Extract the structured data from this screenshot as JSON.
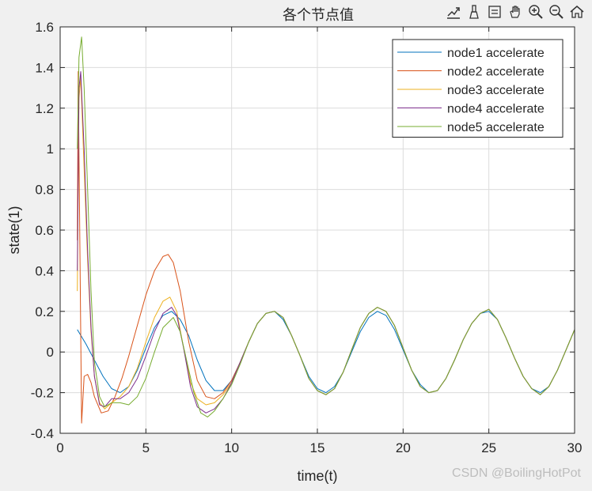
{
  "chart_data": {
    "type": "line",
    "title": "各个节点值",
    "xlabel": "time(t)",
    "ylabel": "state(1)",
    "xlim": [
      0,
      30
    ],
    "ylim": [
      -0.4,
      1.6
    ],
    "xticks": [
      "0",
      "5",
      "10",
      "15",
      "20",
      "25",
      "30"
    ],
    "yticks": [
      "-0.4",
      "-0.2",
      "0",
      "0.2",
      "0.4",
      "0.6",
      "0.8",
      "1",
      "1.2",
      "1.4",
      "1.6"
    ],
    "grid": true,
    "legend_position": "top-right",
    "series": [
      {
        "name": "node1 accelerate",
        "color": "#0072bd",
        "x": [
          1.0,
          1.5,
          2.0,
          2.5,
          3.0,
          3.5,
          4.0,
          4.5,
          5.0,
          5.5,
          6.0,
          6.5,
          7.0,
          7.5,
          8.0,
          8.5,
          9.0,
          9.5,
          10.0,
          10.5,
          11.0,
          11.5,
          12.0,
          12.5,
          13.0,
          13.5,
          14.0,
          14.5,
          15.0,
          15.5,
          16.0,
          16.5,
          17.0,
          17.5,
          18.0,
          18.5,
          19.0,
          19.5,
          20.0,
          20.5,
          21.0,
          21.5,
          22.0,
          22.5,
          23.0,
          23.5,
          24.0,
          24.5,
          25.0,
          25.5,
          26.0,
          26.5,
          27.0,
          27.5,
          28.0,
          28.5,
          29.0,
          29.5,
          30.0
        ],
        "y": [
          0.11,
          0.04,
          -0.04,
          -0.12,
          -0.18,
          -0.2,
          -0.17,
          -0.09,
          0.02,
          0.12,
          0.18,
          0.2,
          0.16,
          0.08,
          -0.04,
          -0.14,
          -0.19,
          -0.19,
          -0.14,
          -0.05,
          0.05,
          0.14,
          0.19,
          0.2,
          0.16,
          0.08,
          -0.02,
          -0.12,
          -0.18,
          -0.2,
          -0.17,
          -0.1,
          0.0,
          0.1,
          0.17,
          0.2,
          0.18,
          0.11,
          0.01,
          -0.09,
          -0.16,
          -0.2,
          -0.19,
          -0.13,
          -0.04,
          0.06,
          0.14,
          0.19,
          0.2,
          0.16,
          0.07,
          -0.03,
          -0.12,
          -0.18,
          -0.2,
          -0.17,
          -0.09,
          0.01,
          0.11
        ]
      },
      {
        "name": "node2 accelerate",
        "color": "#d95319",
        "x": [
          1.0,
          1.05,
          1.25,
          1.4,
          1.6,
          1.8,
          2.0,
          2.4,
          2.8,
          3.2,
          3.6,
          4.0,
          4.5,
          5.0,
          5.5,
          6.0,
          6.3,
          6.6,
          7.0,
          7.5,
          8.0,
          8.5,
          9.0,
          9.5,
          10.0,
          10.5,
          11.0,
          11.5,
          12.0,
          12.5,
          13.0,
          13.5,
          14.0,
          14.5,
          15.0,
          15.5,
          16.0,
          16.5,
          17.0,
          17.5,
          18.0,
          18.5,
          19.0,
          19.5,
          20.0,
          20.5,
          21.0,
          21.5,
          22.0,
          22.5,
          23.0,
          23.5,
          24.0,
          24.5,
          25.0,
          25.5,
          26.0,
          26.5,
          27.0,
          27.5,
          28.0,
          28.5,
          29.0,
          29.5,
          30.0
        ],
        "y": [
          0.55,
          1.38,
          -0.35,
          -0.12,
          -0.11,
          -0.15,
          -0.22,
          -0.3,
          -0.29,
          -0.22,
          -0.13,
          -0.02,
          0.13,
          0.28,
          0.4,
          0.47,
          0.48,
          0.44,
          0.3,
          0.05,
          -0.14,
          -0.22,
          -0.23,
          -0.2,
          -0.14,
          -0.05,
          0.05,
          0.14,
          0.19,
          0.2,
          0.17,
          0.08,
          -0.02,
          -0.13,
          -0.19,
          -0.21,
          -0.18,
          -0.1,
          0.01,
          0.12,
          0.19,
          0.22,
          0.2,
          0.13,
          0.02,
          -0.09,
          -0.17,
          -0.2,
          -0.19,
          -0.13,
          -0.04,
          0.06,
          0.14,
          0.19,
          0.21,
          0.16,
          0.07,
          -0.03,
          -0.12,
          -0.18,
          -0.21,
          -0.17,
          -0.09,
          0.01,
          0.11
        ]
      },
      {
        "name": "node3 accelerate",
        "color": "#edb120",
        "x": [
          1.0,
          1.1,
          1.2,
          1.4,
          1.6,
          1.8,
          2.0,
          2.3,
          2.6,
          3.0,
          3.5,
          4.0,
          4.5,
          5.0,
          5.5,
          6.0,
          6.4,
          6.8,
          7.2,
          7.6,
          8.0,
          8.5,
          9.0,
          9.5,
          10.0,
          10.5,
          11.0,
          11.5,
          12.0,
          12.5,
          13.0,
          13.5,
          14.0,
          14.5,
          15.0,
          15.5,
          16.0,
          16.5,
          17.0,
          17.5,
          18.0,
          18.5,
          19.0,
          19.5,
          20.0,
          20.5,
          21.0,
          21.5,
          22.0,
          22.5,
          23.0,
          23.5,
          24.0,
          24.5,
          25.0,
          25.5,
          26.0,
          26.5,
          27.0,
          27.5,
          28.0,
          28.5,
          29.0,
          29.5,
          30.0
        ],
        "y": [
          0.3,
          1.25,
          1.35,
          0.9,
          0.45,
          0.1,
          -0.12,
          -0.25,
          -0.28,
          -0.25,
          -0.22,
          -0.17,
          -0.08,
          0.05,
          0.17,
          0.25,
          0.27,
          0.2,
          0.02,
          -0.15,
          -0.23,
          -0.26,
          -0.25,
          -0.21,
          -0.15,
          -0.05,
          0.05,
          0.14,
          0.19,
          0.2,
          0.17,
          0.08,
          -0.02,
          -0.13,
          -0.19,
          -0.21,
          -0.18,
          -0.1,
          0.01,
          0.12,
          0.19,
          0.22,
          0.2,
          0.13,
          0.02,
          -0.09,
          -0.17,
          -0.2,
          -0.19,
          -0.13,
          -0.04,
          0.06,
          0.14,
          0.19,
          0.21,
          0.16,
          0.07,
          -0.03,
          -0.12,
          -0.18,
          -0.21,
          -0.17,
          -0.09,
          0.01,
          0.11
        ]
      },
      {
        "name": "node4 accelerate",
        "color": "#7e2f8e",
        "x": [
          1.0,
          1.1,
          1.2,
          1.4,
          1.6,
          1.8,
          2.0,
          2.3,
          2.6,
          3.0,
          3.5,
          4.0,
          4.5,
          5.0,
          5.5,
          6.0,
          6.5,
          6.8,
          7.2,
          7.6,
          8.0,
          8.5,
          9.0,
          9.5,
          10.0,
          10.5,
          11.0,
          11.5,
          12.0,
          12.5,
          13.0,
          13.5,
          14.0,
          14.5,
          15.0,
          15.5,
          16.0,
          16.5,
          17.0,
          17.5,
          18.0,
          18.5,
          19.0,
          19.5,
          20.0,
          20.5,
          21.0,
          21.5,
          22.0,
          22.5,
          23.0,
          23.5,
          24.0,
          24.5,
          25.0,
          25.5,
          26.0,
          26.5,
          27.0,
          27.5,
          28.0,
          28.5,
          29.0,
          29.5,
          30.0
        ],
        "y": [
          0.4,
          1.3,
          1.38,
          1.0,
          0.5,
          0.12,
          -0.12,
          -0.26,
          -0.27,
          -0.23,
          -0.23,
          -0.2,
          -0.13,
          -0.02,
          0.1,
          0.19,
          0.22,
          0.18,
          0.02,
          -0.17,
          -0.27,
          -0.3,
          -0.28,
          -0.23,
          -0.15,
          -0.05,
          0.05,
          0.14,
          0.19,
          0.2,
          0.17,
          0.08,
          -0.02,
          -0.13,
          -0.19,
          -0.21,
          -0.18,
          -0.1,
          0.01,
          0.12,
          0.19,
          0.22,
          0.2,
          0.13,
          0.02,
          -0.09,
          -0.17,
          -0.2,
          -0.19,
          -0.13,
          -0.04,
          0.06,
          0.14,
          0.19,
          0.21,
          0.16,
          0.07,
          -0.03,
          -0.12,
          -0.18,
          -0.21,
          -0.17,
          -0.09,
          0.01,
          0.11
        ]
      },
      {
        "name": "node5 accelerate",
        "color": "#77ac30",
        "x": [
          1.0,
          1.1,
          1.25,
          1.4,
          1.6,
          1.8,
          2.0,
          2.3,
          2.6,
          3.0,
          3.5,
          4.0,
          4.5,
          5.0,
          5.5,
          6.0,
          6.6,
          7.0,
          7.4,
          7.8,
          8.2,
          8.6,
          9.0,
          9.5,
          10.0,
          10.5,
          11.0,
          11.5,
          12.0,
          12.5,
          13.0,
          13.5,
          14.0,
          14.5,
          15.0,
          15.5,
          16.0,
          16.5,
          17.0,
          17.5,
          18.0,
          18.5,
          19.0,
          19.5,
          20.0,
          20.5,
          21.0,
          21.5,
          22.0,
          22.5,
          23.0,
          23.5,
          24.0,
          24.5,
          25.0,
          25.5,
          26.0,
          26.5,
          27.0,
          27.5,
          28.0,
          28.5,
          29.0,
          29.5,
          30.0
        ],
        "y": [
          1.0,
          1.45,
          1.55,
          1.3,
          0.8,
          0.3,
          -0.05,
          -0.22,
          -0.27,
          -0.25,
          -0.25,
          -0.26,
          -0.22,
          -0.13,
          0.0,
          0.12,
          0.17,
          0.1,
          -0.05,
          -0.2,
          -0.3,
          -0.32,
          -0.29,
          -0.23,
          -0.16,
          -0.06,
          0.05,
          0.14,
          0.19,
          0.2,
          0.17,
          0.08,
          -0.02,
          -0.13,
          -0.19,
          -0.21,
          -0.18,
          -0.1,
          0.01,
          0.12,
          0.19,
          0.22,
          0.2,
          0.13,
          0.02,
          -0.09,
          -0.17,
          -0.2,
          -0.19,
          -0.13,
          -0.04,
          0.06,
          0.14,
          0.19,
          0.21,
          0.16,
          0.07,
          -0.03,
          -0.12,
          -0.18,
          -0.21,
          -0.17,
          -0.09,
          0.01,
          0.11
        ]
      }
    ]
  },
  "toolbar": {
    "icons": [
      "export-icon",
      "brush-icon",
      "datatip-icon",
      "pan-icon",
      "zoom-in-icon",
      "zoom-out-icon",
      "home-icon"
    ]
  },
  "watermark": "CSDN @BoilingHotPot"
}
